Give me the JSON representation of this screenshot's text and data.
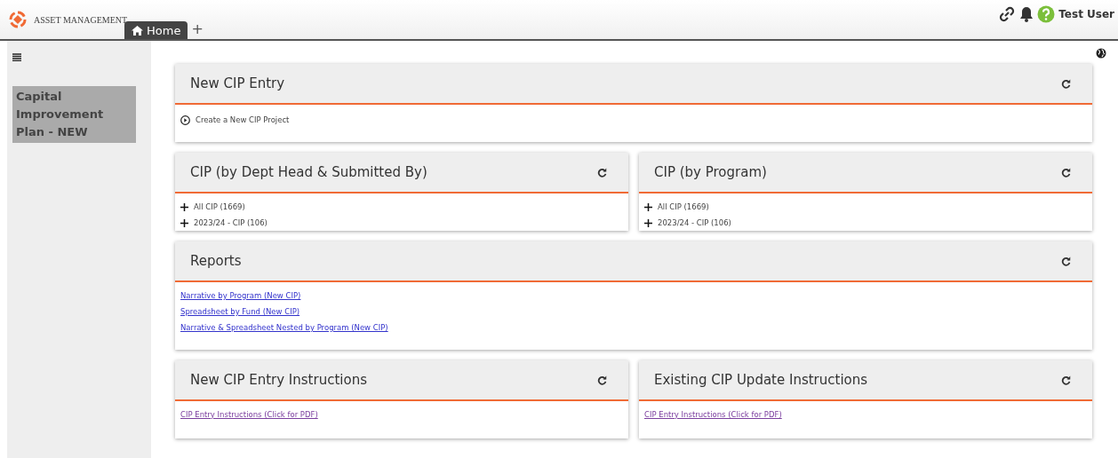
{
  "header": {
    "app_name": "ASSET MANAGEMENT",
    "tabs": [
      {
        "label": "Home",
        "selected": true
      }
    ],
    "add_tab": "+",
    "user": "Test User"
  },
  "sidebar": {
    "items": [
      {
        "label": "Capital Improvement Plan - NEW",
        "selected": true
      }
    ]
  },
  "rows": [
    {
      "cards": [
        {
          "title": "New CIP Entry",
          "kind": "action",
          "items": [
            {
              "label": "Create a New CIP Project"
            }
          ]
        }
      ]
    },
    {
      "cards": [
        {
          "title": "CIP (by Dept Head & Submitted By)",
          "kind": "tree",
          "items": [
            {
              "label": "All CIP (1669)",
              "expanded": false
            },
            {
              "label": "2023/24 - CIP (106)",
              "expanded": false
            }
          ]
        },
        {
          "title": "CIP (by Program)",
          "kind": "tree",
          "items": [
            {
              "label": "All CIP (1669)",
              "expanded": false
            },
            {
              "label": "2023/24 - CIP (106)",
              "expanded": false
            }
          ]
        }
      ]
    },
    {
      "cards": [
        {
          "title": "Reports",
          "kind": "links",
          "items": [
            {
              "label": "Narrative by Program (New CIP)",
              "visited": false
            },
            {
              "label": "Spreadsheet by Fund (New CIP)",
              "visited": false
            },
            {
              "label": "Narrative & Spreadsheet Nested by Program (New CIP)",
              "visited": false
            }
          ]
        }
      ]
    },
    {
      "cards": [
        {
          "title": "New CIP Entry Instructions",
          "kind": "links",
          "items": [
            {
              "label": "CIP Entry Instructions (Click for PDF)",
              "visited": true
            }
          ]
        },
        {
          "title": "Existing CIP Update Instructions",
          "kind": "links",
          "items": [
            {
              "label": "CIP Entry Instructions (Click for PDF)",
              "visited": true
            }
          ]
        }
      ]
    }
  ]
}
